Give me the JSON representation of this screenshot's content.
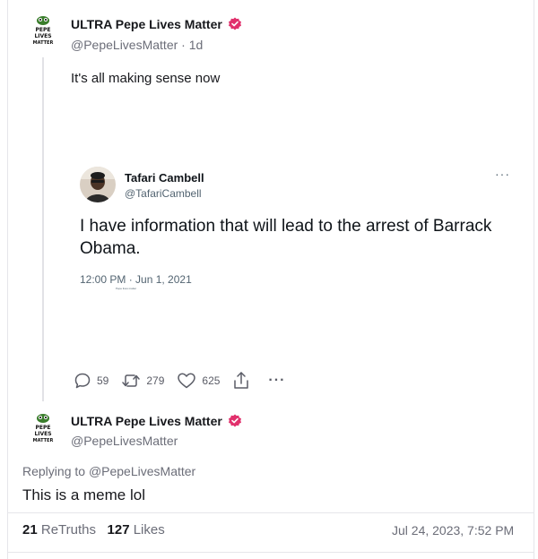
{
  "original_post": {
    "display_name": "ULTRA Pepe Lives Matter",
    "handle": "@PepeLivesMatter",
    "age": "· 1d",
    "text": "It's all making sense now",
    "avatar_text": "PEPE LIVES MATTER"
  },
  "embedded_tweet": {
    "display_name": "Tafari Cambell",
    "handle": "@TafariCambell",
    "more": "···",
    "text": "I have information that will lead to the arrest of Barrack Obama.",
    "timestamp": "12:00 PM · Jun 1, 2021",
    "tiny_caption": "Pepe lives matter"
  },
  "actions": {
    "replies": "59",
    "retruths": "279",
    "likes": "625",
    "more": "···"
  },
  "reply_post": {
    "display_name": "ULTRA Pepe Lives Matter",
    "handle": "@PepeLivesMatter",
    "replying_prefix": "Replying to",
    "replying_to": "@PepeLivesMatter",
    "text": "This is a meme lol",
    "retruths_count": "21",
    "retruths_label": "ReTruths",
    "likes_count": "127",
    "likes_label": "Likes",
    "date": "Jul 24, 2023, 7:52 PM"
  },
  "colors": {
    "verified_badge": "#e1306c",
    "muted_text": "#6b6d78"
  },
  "icons": {
    "reply": "comment-icon",
    "retruth": "repost-icon",
    "like": "heart-icon",
    "share": "share-icon",
    "more": "more-dots-icon",
    "verified": "verified-badge-icon"
  }
}
